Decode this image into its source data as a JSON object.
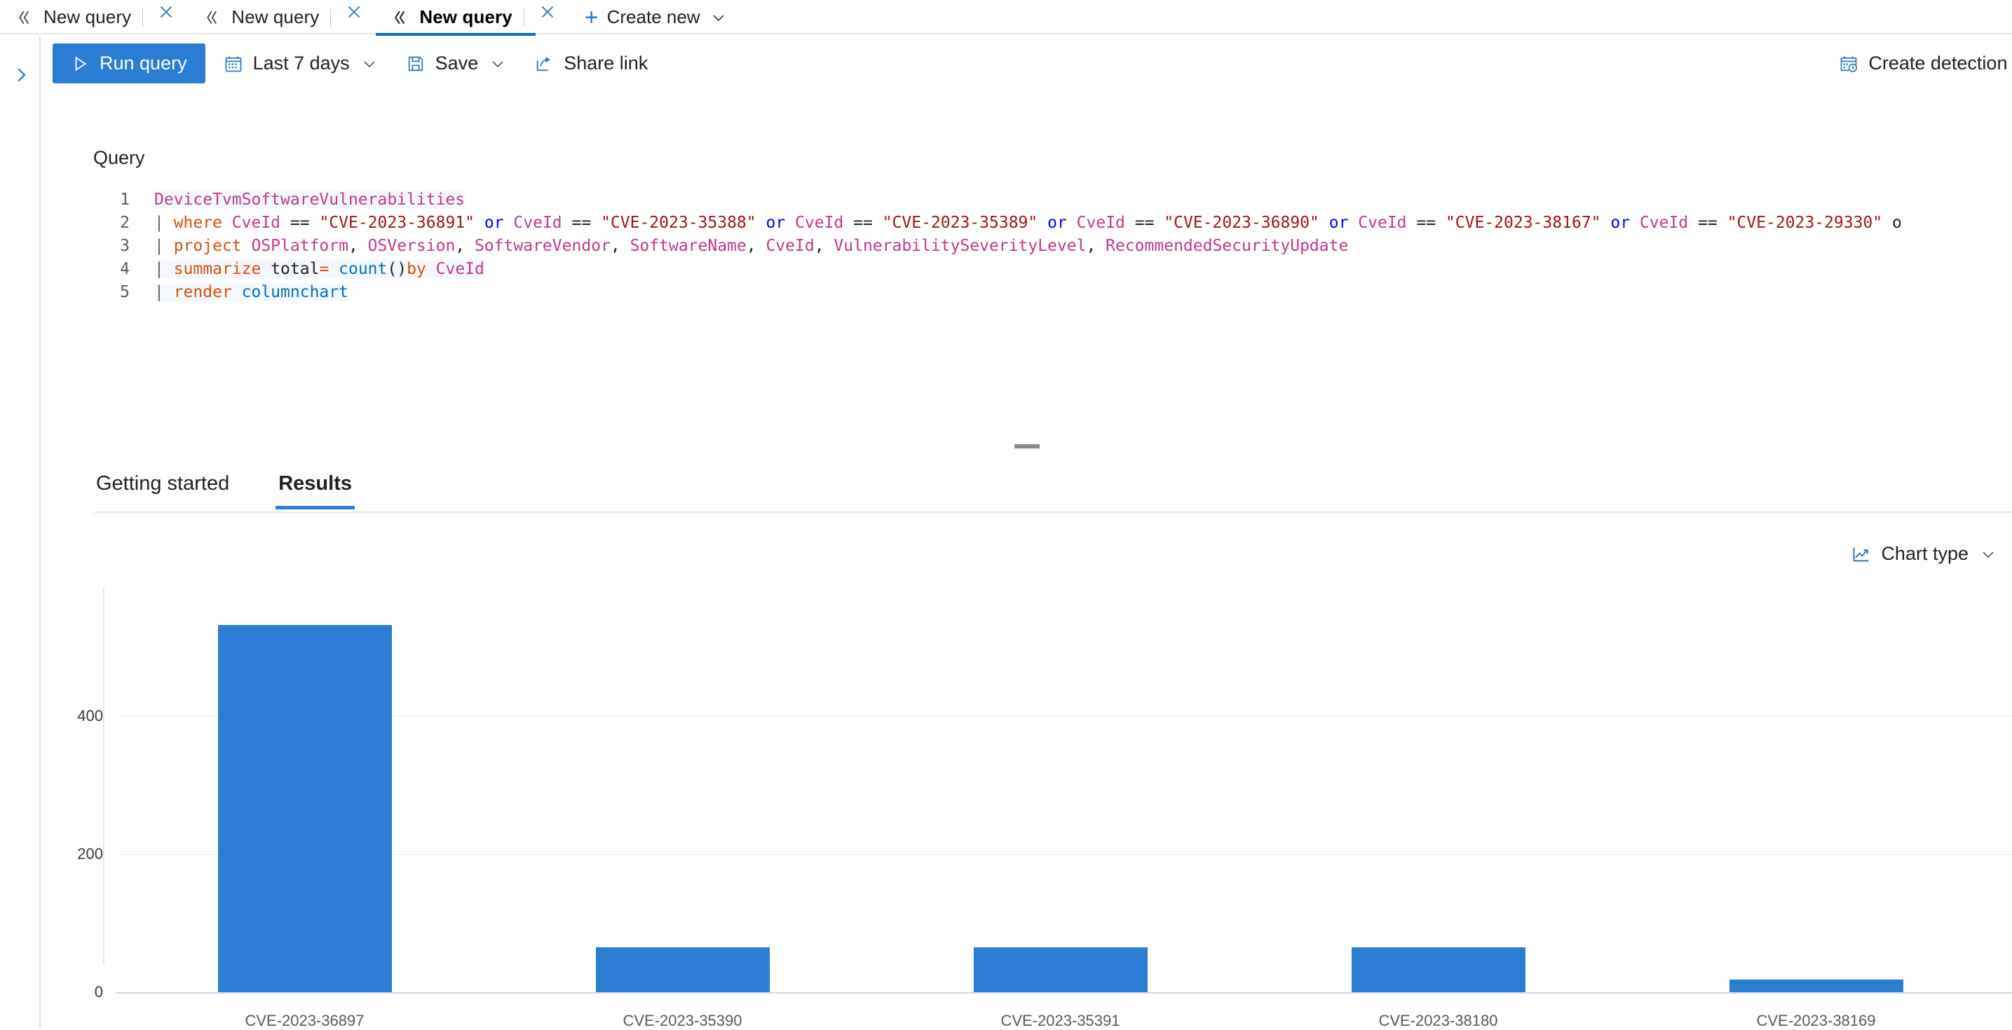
{
  "tabs": {
    "items": [
      {
        "label": "New query",
        "icon": "code-icon",
        "active": false
      },
      {
        "label": "New query",
        "icon": "code-icon",
        "active": false
      },
      {
        "label": "New query",
        "icon": "code-icon",
        "active": true
      }
    ],
    "create_new_label": "Create new"
  },
  "command_bar": {
    "run_query_label": "Run query",
    "time_range_label": "Last 7 days",
    "save_label": "Save",
    "share_link_label": "Share link",
    "create_detection_rule_label": "Create detection rule"
  },
  "query": {
    "section_label": "Query",
    "lines": [
      {
        "n": "1",
        "text": "DeviceTvmSoftwareVulnerabilities"
      },
      {
        "n": "2",
        "text": "| where CveId == \"CVE-2023-36891\" or CveId == \"CVE-2023-35388\" or CveId == \"CVE-2023-35389\" or CveId == \"CVE-2023-36890\" or CveId == \"CVE-2023-38167\" or CveId == \"CVE-2023-29330\" o"
      },
      {
        "n": "3",
        "text": "| project OSPlatform, OSVersion, SoftwareVendor, SoftwareName, CveId, VulnerabilitySeverityLevel, RecommendedSecurityUpdate"
      },
      {
        "n": "4",
        "text": "| summarize total= count()by CveId"
      },
      {
        "n": "5",
        "text": "| render columnchart"
      }
    ]
  },
  "results": {
    "tabs": [
      {
        "label": "Getting started",
        "active": false
      },
      {
        "label": "Results",
        "active": true
      }
    ],
    "chart_type_label": "Chart type"
  },
  "chart_data": {
    "type": "bar",
    "title": "",
    "xlabel": "",
    "ylabel": "",
    "categories": [
      "CVE-2023-36897",
      "CVE-2023-35390",
      "CVE-2023-35391",
      "CVE-2023-38180",
      "CVE-2023-38169"
    ],
    "values": [
      533,
      65,
      65,
      65,
      18
    ],
    "series": [
      {
        "name": "total",
        "values": [
          533,
          65,
          65,
          65,
          18
        ]
      }
    ],
    "yticks": [
      0,
      200,
      400
    ],
    "ylim": [
      0,
      560
    ],
    "grid": true,
    "legend": false,
    "bar_color": "#2b7cd3"
  },
  "colors": {
    "accent": "#2b7cd3",
    "tab_underline": "#0f6cbd",
    "icon_blue": "#2b79c2"
  }
}
